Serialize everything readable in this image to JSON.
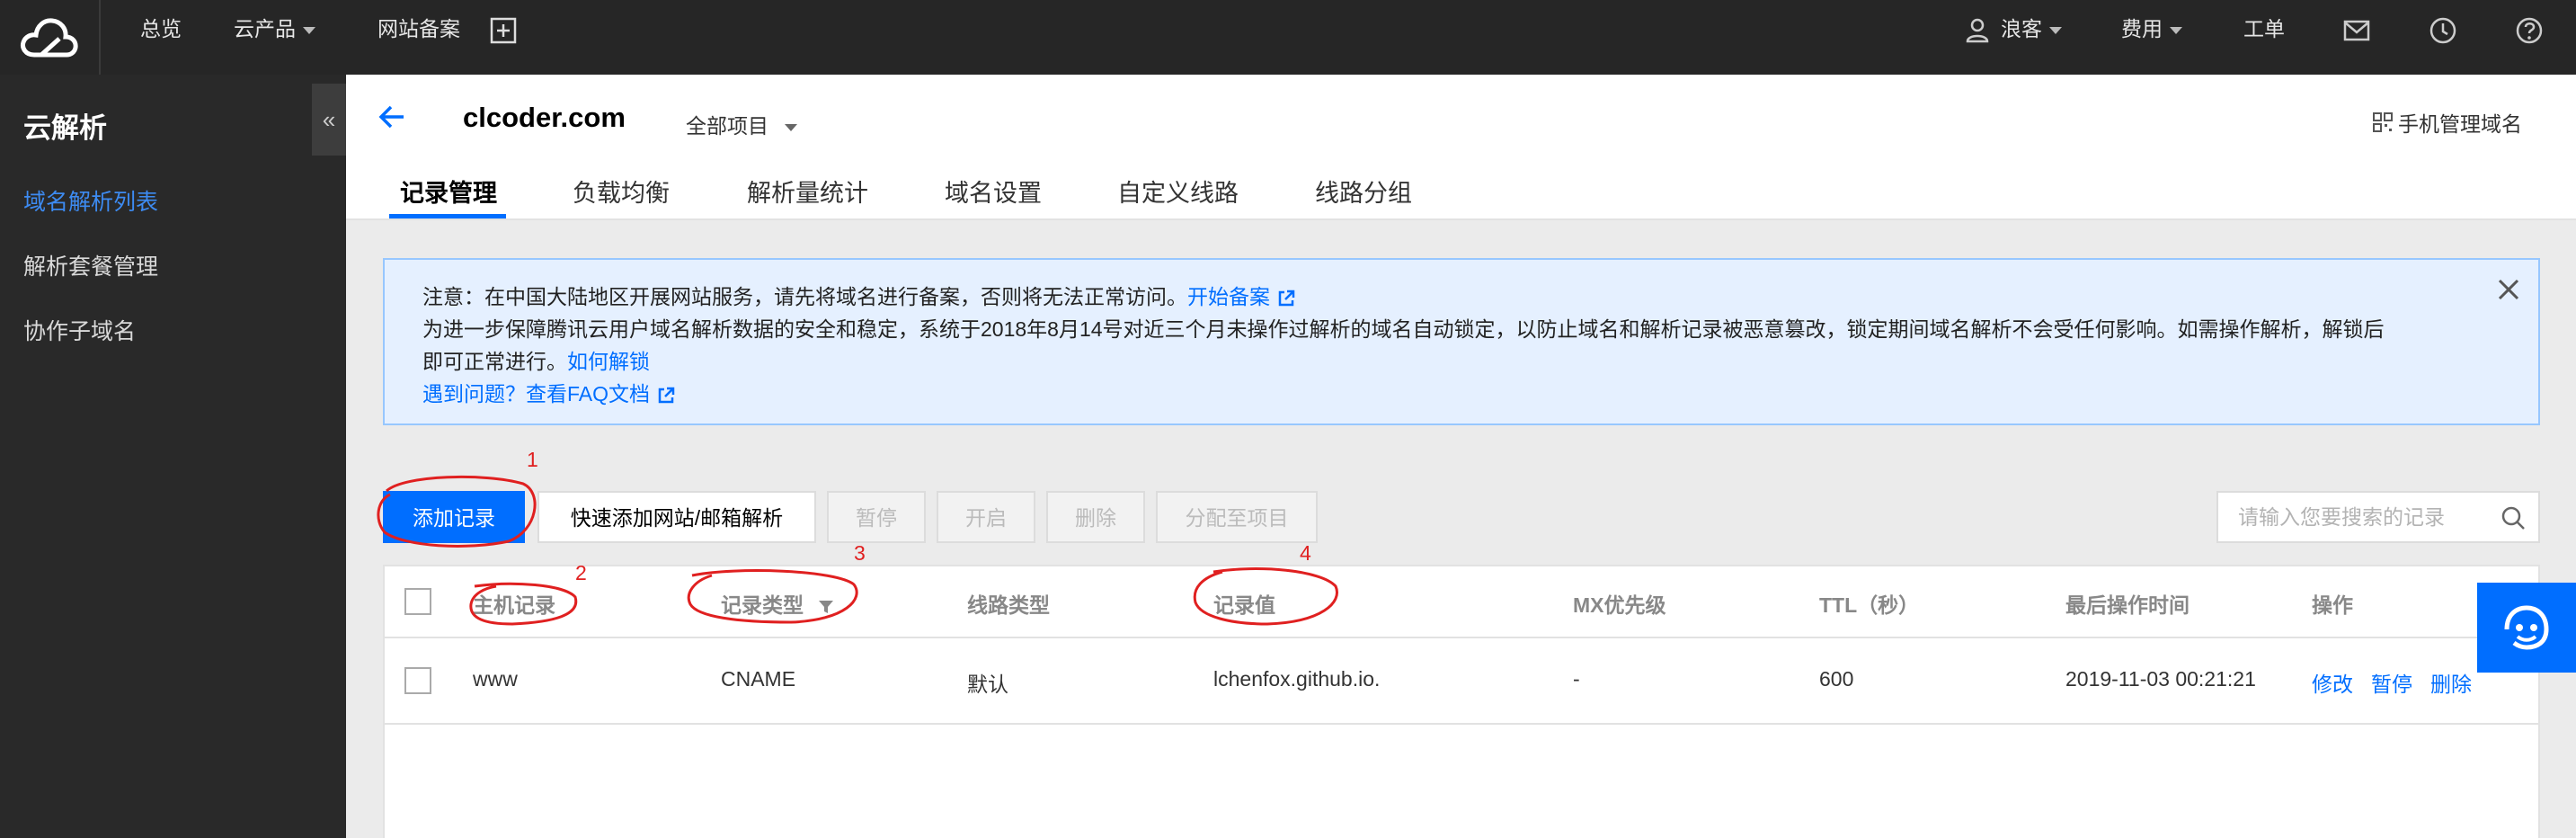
{
  "topnav": {
    "items": [
      "总览",
      "云产品",
      "网站备案"
    ],
    "user": "浪客",
    "billing": "费用",
    "ticket": "工单"
  },
  "sidebar": {
    "title": "云解析",
    "items": [
      {
        "label": "域名解析列表",
        "active": true
      },
      {
        "label": "解析套餐管理",
        "active": false
      },
      {
        "label": "协作子域名",
        "active": false
      }
    ],
    "collapse_glyph": "«"
  },
  "header": {
    "domain": "clcoder.com",
    "project": "全部项目",
    "mobile_manage": "手机管理域名",
    "tabs": [
      "记录管理",
      "负载均衡",
      "解析量统计",
      "域名设置",
      "自定义线路",
      "线路分组"
    ],
    "active_tab": 0
  },
  "notice": {
    "line1": "注意：在中国大陆地区开展网站服务，请先将域名进行备案，否则将无法正常访问。",
    "line1_link": "开始备案",
    "line2": "为进一步保障腾讯云用户域名解析数据的安全和稳定，系统于2018年8月14号对近三个月未操作过解析的域名自动锁定，以防止域名和解析记录被恶意篡改，锁定期间域名解析不会受任何影响。如需操作解析，解锁后",
    "line3": "即可正常进行。",
    "line3_link": "如何解锁",
    "line4_link": "遇到问题？查看FAQ文档"
  },
  "toolbar": {
    "add_record": "添加记录",
    "quick_add": "快速添加网站/邮箱解析",
    "pause": "暂停",
    "enable": "开启",
    "delete": "删除",
    "assign": "分配至项目",
    "search_placeholder": "请输入您要搜索的记录"
  },
  "table": {
    "columns": [
      "主机记录",
      "记录类型",
      "线路类型",
      "记录值",
      "MX优先级",
      "TTL（秒）",
      "最后操作时间",
      "操作"
    ],
    "rows": [
      {
        "host": "www",
        "type": "CNAME",
        "line": "默认",
        "value": "lchenfox.github.io.",
        "mx": "-",
        "ttl": "600",
        "time": "2019-11-03 00:21:21",
        "actions": [
          "修改",
          "暂停",
          "删除"
        ]
      }
    ]
  },
  "annotations": [
    "1",
    "2",
    "3",
    "4"
  ],
  "colors": {
    "primary": "#006eff",
    "topbar": "#262626",
    "sidebar": "#292929",
    "notice_bg": "#e5f0ff",
    "annotation": "#e02020"
  }
}
